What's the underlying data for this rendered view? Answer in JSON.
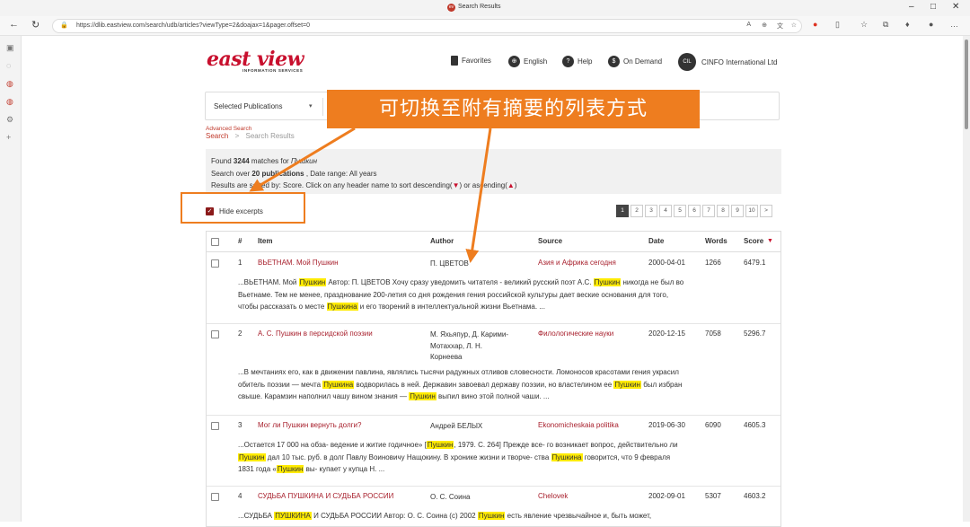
{
  "browser": {
    "tab_title": "Search Results",
    "url": "https://dlib.eastview.com/search/udb/articles?viewType=2&doajax=1&pager.offset=0"
  },
  "site": {
    "logo_text": "east view",
    "logo_sub": "INFORMATION SERVICES",
    "nav": {
      "favorites": "Favorites",
      "language": "English",
      "help": "Help",
      "on_demand": "On Demand",
      "org_badge": "CIL",
      "org": "CINFO International Ltd"
    }
  },
  "search": {
    "scope_select": "Selected Publications"
  },
  "breadcrumb": {
    "advanced": "Advanced Search",
    "search": "Search",
    "separator": ">",
    "current": "Search Results"
  },
  "summary": {
    "found_prefix": "Found ",
    "found_count": "3244",
    "found_mid": " matches for ",
    "query": "Пушкин",
    "over_prefix": "Search over ",
    "publications": "20 publications",
    "date_range": " , Date range: All years",
    "sort_text": "Results are sorted by: Score. Click on any header name to sort descending(",
    "sort_mid": ")  or ascending(",
    "sort_end": ")"
  },
  "toggle": {
    "label": "Hide excerpts",
    "checked": true
  },
  "pager": {
    "pages": [
      "1",
      "2",
      "3",
      "4",
      "5",
      "6",
      "7",
      "8",
      "9",
      "10"
    ],
    "next": ">"
  },
  "table": {
    "headers": {
      "num": "#",
      "item": "Item",
      "author": "Author",
      "source": "Source",
      "date": "Date",
      "words": "Words",
      "score": "Score"
    },
    "rows": [
      {
        "num": "1",
        "item": "ВЬЕТНАМ. Мой Пушкин",
        "author": [
          "П. ЦВЕТОВ"
        ],
        "source": "Азия и Африка сегодня",
        "date": "2000-04-01",
        "words": "1266",
        "score": "6479.1",
        "excerpt": [
          [
            "...ВЬЕТНАМ. Мой ",
            "Пушкин",
            " Автор: П. ЦВЕТОВ Хочу сразу уведомить читателя - великий русский поэт А.С. ",
            "Пушкин",
            " никогда не был во"
          ],
          [
            "Вьетнаме. Тем не менее, празднование 200-летия со дня рождения гения российской культуры дает веские основания для того,"
          ],
          [
            "чтобы рассказать о месте ",
            "Пушкина",
            " и его творений в интеллектуальной жизни Вьетнама. ..."
          ]
        ]
      },
      {
        "num": "2",
        "item": "А. С. Пушкин в персидской поэзии",
        "author": [
          "М. Яхьяпур, Д. Карими-",
          "Мотаххар, Л. Н.",
          "Корнеева"
        ],
        "source": "Филологические науки",
        "date": "2020-12-15",
        "words": "7058",
        "score": "5296.7",
        "excerpt": [
          [
            "...В мечтаниях его, как в движении павлина, являлись тысячи радужных отливов словесности. Ломоносов красотами гения украсил"
          ],
          [
            "обитель поэзии — мечта ",
            "Пушкина",
            " водворилась в ней. Державин завоевал державу поэзии, но властелином ее ",
            "Пушкин",
            " был избран"
          ],
          [
            "свыше. Карамзин наполнил чашу вином знания — ",
            "Пушкин",
            " выпил вино этой полной чаши. ..."
          ]
        ]
      },
      {
        "num": "3",
        "item": "Мог ли Пушкин вернуть долги?",
        "author": [
          "Андрей БЕЛЫХ"
        ],
        "source": "Ekonomicheskaia politika",
        "date": "2019-06-30",
        "words": "6090",
        "score": "4605.3",
        "excerpt": [
          [
            "...Остается 17 000 на обза- ведение и житие годичное» [",
            "Пушкин",
            ", 1979. С. 264] Прежде все- го возникает вопрос, действительно ли"
          ],
          [
            "",
            "Пушкин",
            " дал 10 тыс. руб. в долг Павлу Воиновичу Нащокину. В хронике жизни и творче- ства ",
            "Пушкина",
            " говорится, что 9 февраля"
          ],
          [
            "1831 года «",
            "Пушкин",
            " вы- купает у купца Н. ..."
          ]
        ]
      },
      {
        "num": "4",
        "item": "СУДЬБА ПУШКИНА И СУДЬБА РОССИИ",
        "author": [
          "О. С. Соина"
        ],
        "source": "Chelovek",
        "date": "2002-09-01",
        "words": "5307",
        "score": "4603.2",
        "excerpt": [
          [
            "...СУДЬБА ",
            "ПУШКИНА",
            " И СУДЬБА РОССИИ Автор: О. С. Соина (c) 2002 ",
            "Пушкин",
            " есть явление чрезвычайное и, быть может,"
          ]
        ]
      }
    ]
  },
  "annotation": {
    "callout": "可切换至附有摘要的列表方式"
  },
  "colors": {
    "brand": "#c8102e",
    "link": "#a8202d",
    "highlight": "#ffeb00",
    "annotation": "#ee7d1f"
  }
}
